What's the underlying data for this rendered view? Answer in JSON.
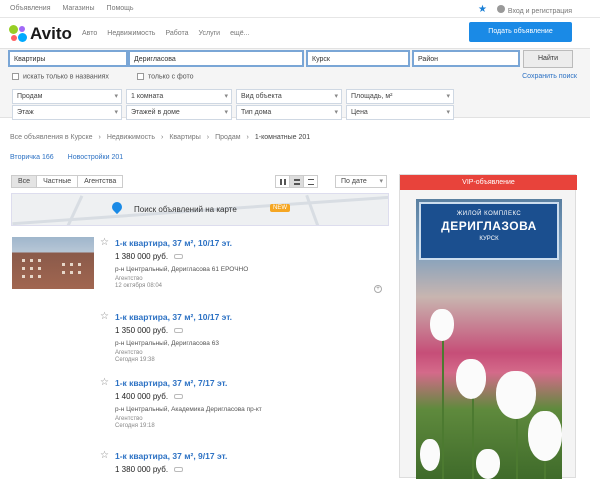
{
  "topbar": {
    "links": [
      "Объявления",
      "Магазины",
      "Помощь"
    ],
    "login": "Вход и регистрация"
  },
  "header": {
    "logo_text": "Avito",
    "categories": [
      "Авто",
      "Недвижимость",
      "Работа",
      "Услуги",
      "ещё..."
    ],
    "submit_label": "Подать объявление"
  },
  "search": {
    "category": "Квартиры",
    "query": "Деригласова",
    "city": "Курск",
    "district": "Район",
    "find_label": "Найти",
    "only_in_title": "искать только в названиях",
    "only_with_photo": "только с фото",
    "save_search": "Сохранить поиск",
    "filters": [
      [
        "Продам",
        "1 комната",
        "Вид объекта",
        "Площадь, м²"
      ],
      [
        "Этаж",
        "Этажей в доме",
        "Тип дома",
        "Цена"
      ]
    ]
  },
  "breadcrumb": [
    "Все объявления в Курске",
    "Недвижимость",
    "Квартиры",
    "Продам",
    "1-комнатные 201"
  ],
  "subtabs": [
    "Вторичка 166",
    "Новостройки 201"
  ],
  "list_controls": {
    "tabs": [
      "Все",
      "Частные",
      "Агентства"
    ],
    "sort": "По дате"
  },
  "map_banner": {
    "text": "Поиск объявлений на карте",
    "badge": "NEW"
  },
  "listings": [
    {
      "title": "1-к квартира, 37 м², 10/17 эт.",
      "price": "1 380 000 руб.",
      "address": "р-н Центральный, Деригласова 61 ЕРОЧНО",
      "agency": "Агентство",
      "date": "12 октября 08:04"
    },
    {
      "title": "1-к квартира, 37 м², 10/17 эт.",
      "price": "1 350 000 руб.",
      "address": "р-н Центральный, Деригласова 63",
      "agency": "Агентство",
      "date": "Сегодня 19:38"
    },
    {
      "title": "1-к квартира, 37 м², 7/17 эт.",
      "price": "1 400 000 руб.",
      "address": "р-н Центральный, Академика Деригласова пр-кт",
      "agency": "Агентство",
      "date": "Сегодня 19:18"
    },
    {
      "title": "1-к квартира, 37 м², 9/17 эт.",
      "price": "1 380 000 руб.",
      "address": "",
      "agency": "",
      "date": ""
    }
  ],
  "ad": {
    "header": "VIP-объявление",
    "plate_line1": "ЖИЛОЙ КОМПЛЕКС",
    "plate_line2": "ДЕРИГЛАЗОВА",
    "plate_line3": "КУРСК"
  }
}
